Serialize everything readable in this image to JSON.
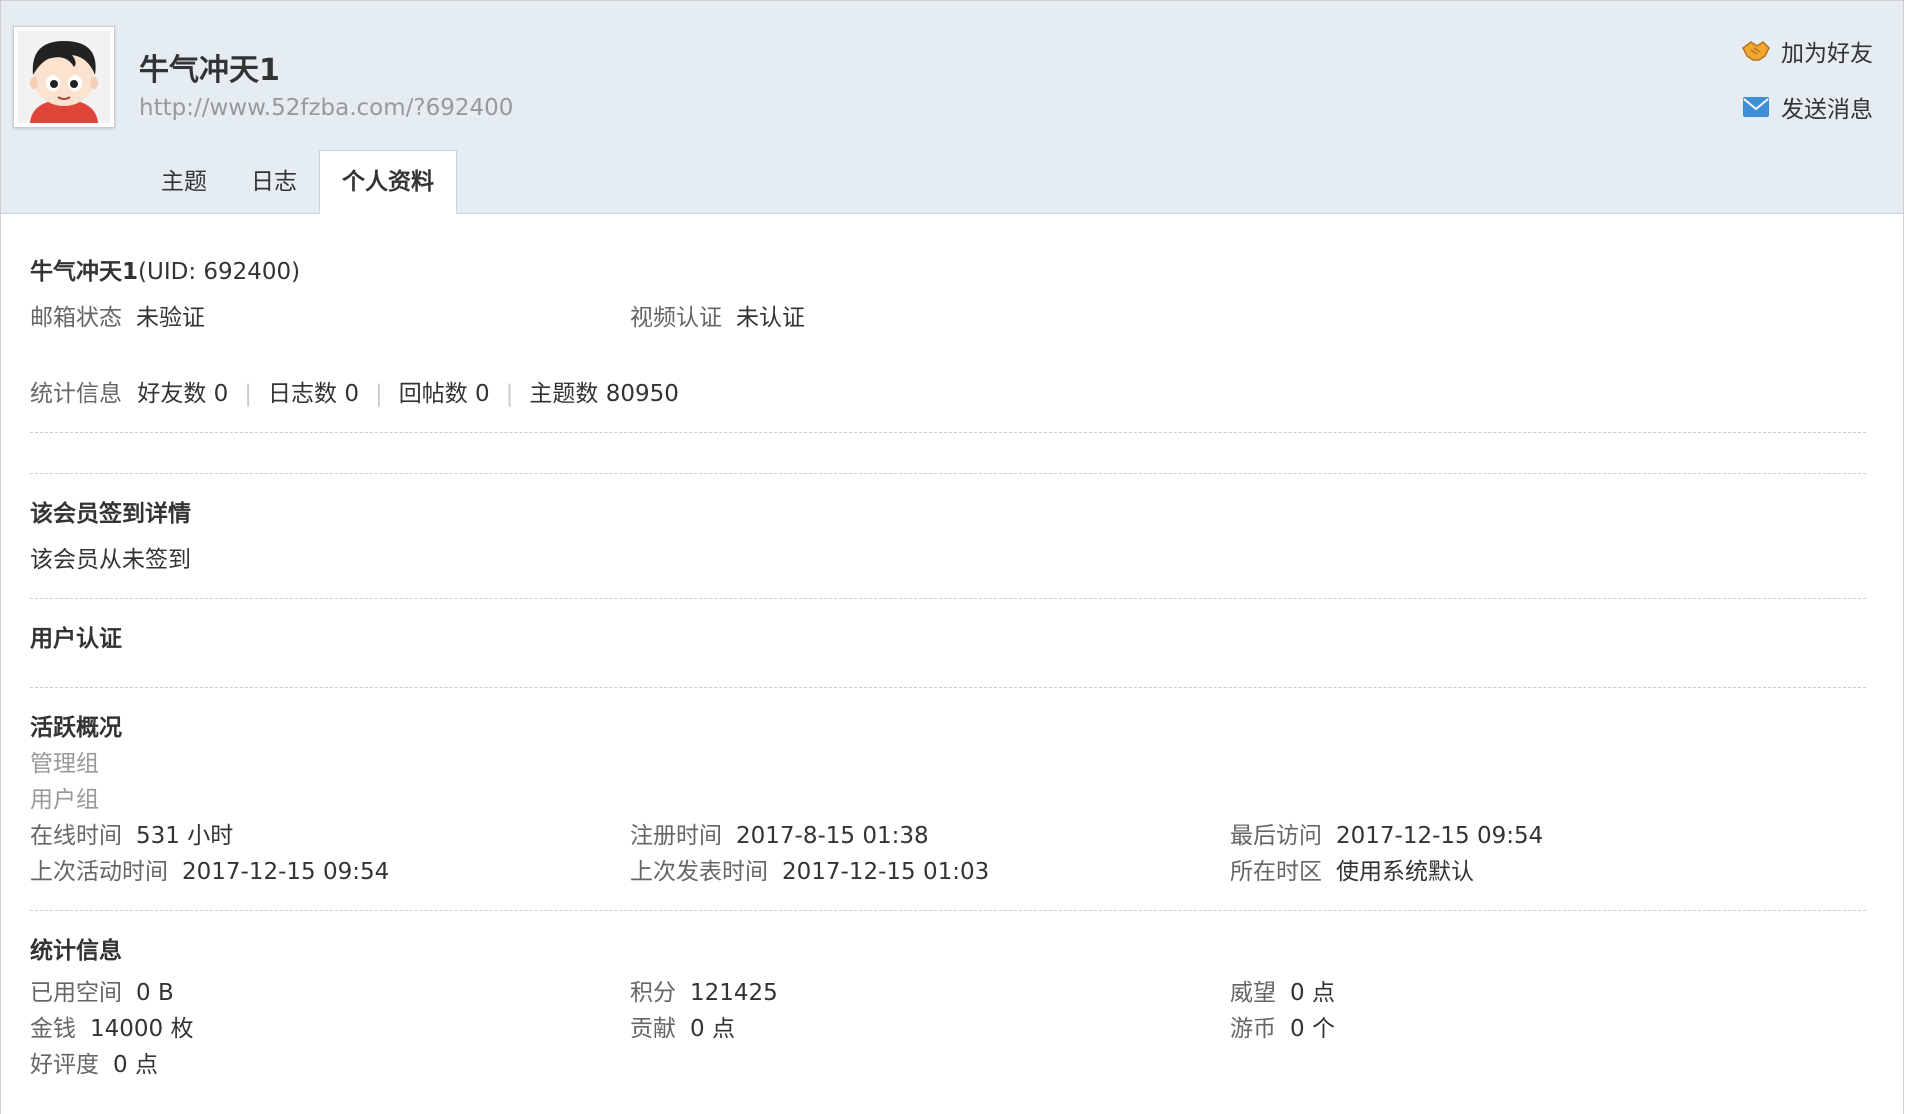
{
  "header": {
    "username": "牛气冲天1",
    "url": "http://www.52fzba.com/?692400",
    "actions": {
      "add_friend": "加为好友",
      "send_message": "发送消息"
    },
    "tabs": [
      "主题",
      "日志",
      "个人资料"
    ],
    "active_tab": "个人资料"
  },
  "profile": {
    "name": "牛气冲天1",
    "uid_text": "(UID: 692400)",
    "email_label": "邮箱状态",
    "email_value": "未验证",
    "video_label": "视频认证",
    "video_value": "未认证",
    "stats_label": "统计信息",
    "stats": [
      "好友数 0",
      "日志数 0",
      "回帖数 0",
      "主题数 80950"
    ]
  },
  "checkin": {
    "title": "该会员签到详情",
    "text": "该会员从未签到"
  },
  "auth": {
    "title": "用户认证"
  },
  "activity": {
    "title": "活跃概况",
    "admin_group_label": "管理组",
    "user_group_label": "用户组",
    "online_label": "在线时间",
    "online_value": "531 小时",
    "reg_label": "注册时间",
    "reg_value": "2017-8-15 01:38",
    "last_visit_label": "最后访问",
    "last_visit_value": "2017-12-15 09:54",
    "last_active_label": "上次活动时间",
    "last_active_value": "2017-12-15 09:54",
    "last_post_label": "上次发表时间",
    "last_post_value": "2017-12-15 01:03",
    "timezone_label": "所在时区",
    "timezone_value": "使用系统默认"
  },
  "statistics": {
    "title": "统计信息",
    "space_label": "已用空间",
    "space_value": "0 B",
    "credits_label": "积分",
    "credits_value": "121425",
    "prestige_label": "威望",
    "prestige_value": "0 点",
    "money_label": "金钱",
    "money_value": "14000 枚",
    "contrib_label": "贡献",
    "contrib_value": "0 点",
    "coins_label": "游币",
    "coins_value": "0 个",
    "rating_label": "好评度",
    "rating_value": "0 点"
  }
}
